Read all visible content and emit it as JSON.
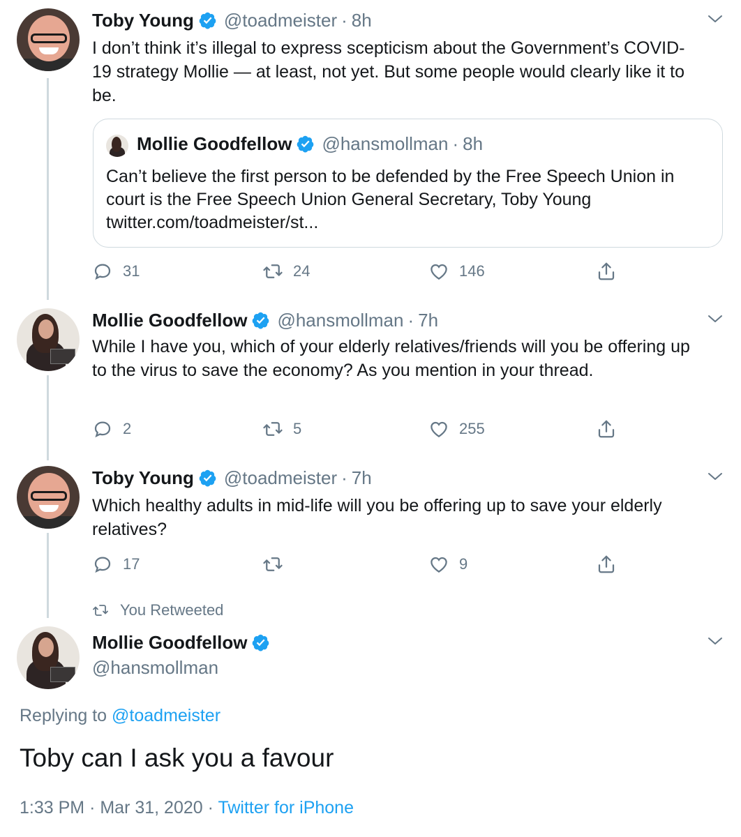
{
  "tweets": [
    {
      "name": "Toby Young",
      "handle": "@toadmeister",
      "sep": "·",
      "time": "8h",
      "text": "I don’t think it’s illegal to express scepticism about the Government’s COVID-19 strategy Mollie — at least, not yet. But some people would clearly like it to be.",
      "quote": {
        "name": "Mollie Goodfellow",
        "handle": "@hansmollman",
        "sep": "·",
        "time": "8h",
        "text": "Can’t believe the first person to be defended by the Free Speech Union in court is the Free Speech Union General Secretary, Toby Young twitter.com/toadmeister/st..."
      },
      "replies": "31",
      "retweets": "24",
      "likes": "146"
    },
    {
      "name": "Mollie Goodfellow",
      "handle": "@hansmollman",
      "sep": "·",
      "time": "7h",
      "text": "While I have you, which of your elderly relatives/friends will you be offering up to the virus to save the economy? As you mention in your thread.",
      "replies": "2",
      "retweets": "5",
      "likes": "255"
    },
    {
      "name": "Toby Young",
      "handle": "@toadmeister",
      "sep": "·",
      "time": "7h",
      "text": "Which healthy adults in mid-life will you be offering up to save your elderly relatives?",
      "replies": "17",
      "retweets": "",
      "likes": "9"
    }
  ],
  "retweet_context": "You Retweeted",
  "main_tweet": {
    "name": "Mollie Goodfellow",
    "handle": "@hansmollman",
    "replying_prefix": "Replying to",
    "replying_to": "@toadmeister",
    "text": "Toby can I ask you a favour",
    "time": "1:33 PM",
    "sep1": "·",
    "date": "Mar 31, 2020",
    "sep2": "·",
    "client": "Twitter for iPhone"
  },
  "icons": {
    "verified": "verified-badge-icon",
    "reply": "reply-icon",
    "retweet": "retweet-icon",
    "like": "heart-icon",
    "share": "share-icon",
    "more": "chevron-down-icon"
  },
  "colors": {
    "verified_blue": "#1da1f2",
    "link_blue": "#1da1f2",
    "secondary_text": "#657786",
    "primary_text": "#14171a"
  }
}
